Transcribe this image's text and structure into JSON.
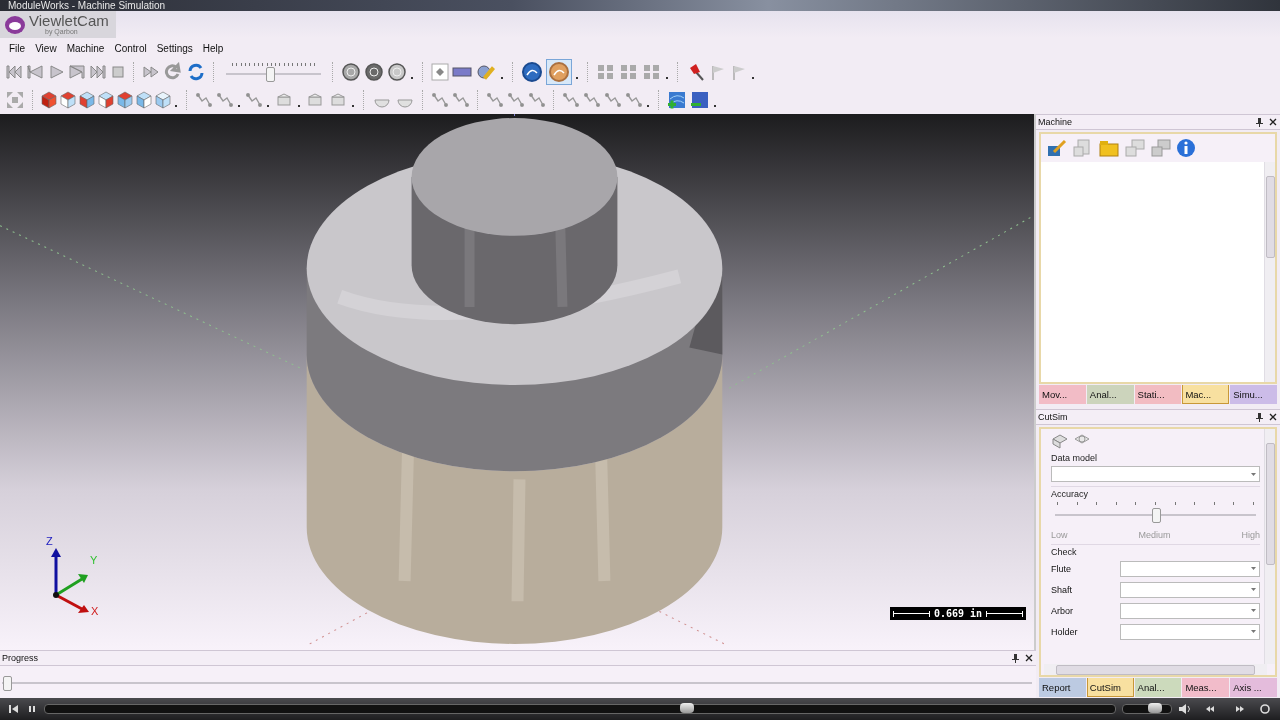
{
  "window": {
    "title": "ModuleWorks - Machine Simulation"
  },
  "logo": {
    "name": "ViewletCam",
    "tagline": "by Qarbon"
  },
  "menu": [
    "File",
    "View",
    "Machine",
    "Control",
    "Settings",
    "Help"
  ],
  "toolbar": {
    "speed_slider": {
      "level": 0.46
    }
  },
  "viewport": {
    "axes": [
      {
        "label": "Z"
      },
      {
        "label": "Y"
      },
      {
        "label": "X"
      }
    ],
    "scale": "0.669 in"
  },
  "machine_panel": {
    "title": "Machine",
    "tabs": [
      {
        "label": "Mov...",
        "selected": false,
        "color": "#f2bcc6"
      },
      {
        "label": "Anal...",
        "selected": false,
        "color": "#ccd4bc"
      },
      {
        "label": "Stati...",
        "selected": false,
        "color": "#f2bcc2"
      },
      {
        "label": "Mac...",
        "selected": true,
        "color": "#f8e0a0"
      },
      {
        "label": "Simu...",
        "selected": false,
        "color": "#ccbce8"
      }
    ]
  },
  "cutsim_panel": {
    "title": "CutSim",
    "data_model": {
      "label": "Data model"
    },
    "accuracy": {
      "label": "Accuracy",
      "level": 0.5,
      "marks": [
        "Low",
        "Medium",
        "High"
      ]
    },
    "check": {
      "label": "Check",
      "fields": [
        "Flute",
        "Shaft",
        "Arbor",
        "Holder"
      ]
    },
    "tabs": [
      {
        "label": "Report",
        "selected": false,
        "color": "#bccae2"
      },
      {
        "label": "CutSim",
        "selected": true,
        "color": "#f8e0a0"
      },
      {
        "label": "Anal...",
        "selected": false,
        "color": "#ccdabc"
      },
      {
        "label": "Meas...",
        "selected": false,
        "color": "#f2bcca"
      },
      {
        "label": "Axis ...",
        "selected": false,
        "color": "#e4bcdc"
      }
    ]
  },
  "progress": {
    "title": "Progress",
    "level": 0
  },
  "player": {
    "level": 0.6,
    "volume": {
      "level": 0.67
    }
  }
}
